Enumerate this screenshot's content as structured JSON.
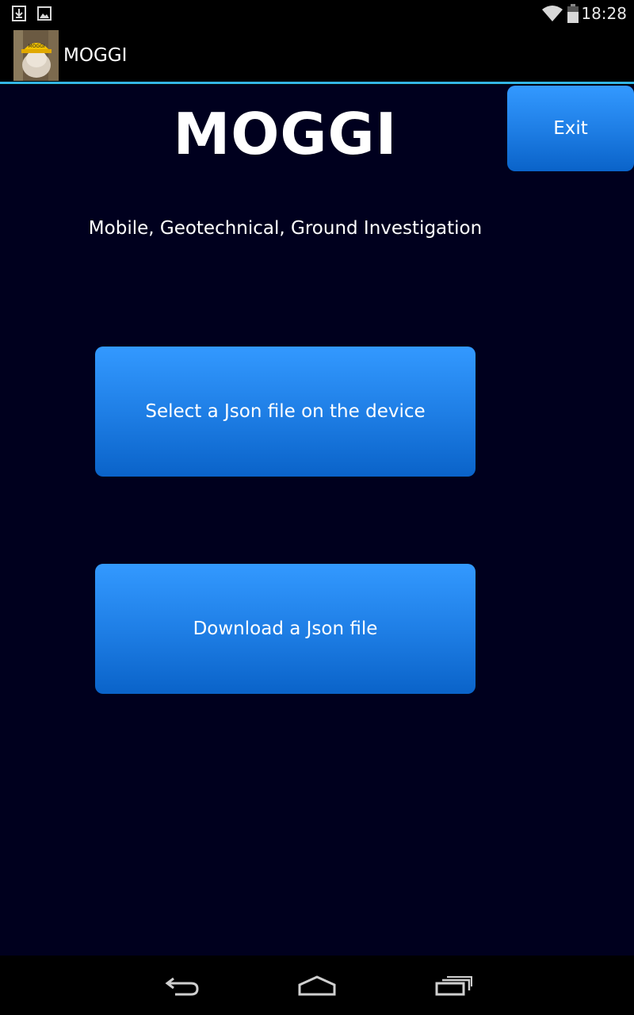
{
  "status_bar": {
    "time": "18:28",
    "icons": [
      "download-notification-icon",
      "image-notification-icon",
      "wifi-icon",
      "battery-icon"
    ]
  },
  "action_bar": {
    "app_icon": "moggi-app-icon",
    "title": "MOGGI",
    "accent_color": "#33b5e5"
  },
  "main": {
    "heading": "MOGGI",
    "subtitle": "Mobile, Geotechnical, Ground Investigation",
    "exit_label": "Exit",
    "select_json_label": "Select a Json file on the device",
    "download_json_label": "Download a Json file",
    "background_color": "#00001e",
    "button_color": "#1f7fe6"
  },
  "nav_bar": {
    "icons": [
      "back-icon",
      "home-icon",
      "recent-apps-icon"
    ]
  }
}
